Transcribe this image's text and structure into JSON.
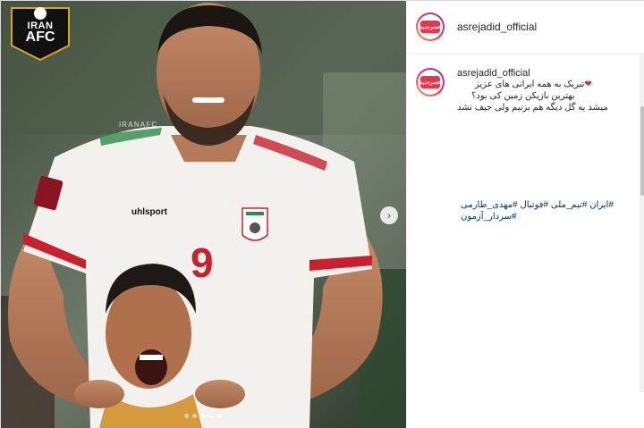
{
  "post": {
    "username": "asrejadid_official",
    "avatar_logo": "عصرجدید",
    "caption": {
      "username": "asrejadid_official",
      "line1": "تبریک به همه ایرانی های عزیز",
      "heart": "❤",
      "line2": "بهترین بازیکن زمین کی بود؟",
      "line3": "میشد یه گل دیگه هم بزنیم ولی حیف نشد",
      "hashtags_line1": "#ایران #تیم_ملی #فوتبال #مهدی_طارمی",
      "hashtags_line2": "#سردار_آزمون"
    }
  },
  "media": {
    "badge_top": "IRAN",
    "badge_bottom": "AFC",
    "watermark": "IRANAFC",
    "jersey_number": "9",
    "jersey_brand": "uhlsport",
    "next_icon": "chevron-right-icon",
    "next_glyph": "›",
    "slide_count": 5,
    "active_slide": 3
  },
  "colors": {
    "accent_red": "#e8344e",
    "link": "#00376b",
    "jersey_white": "#f2f1ee",
    "jersey_red": "#c8202c"
  }
}
